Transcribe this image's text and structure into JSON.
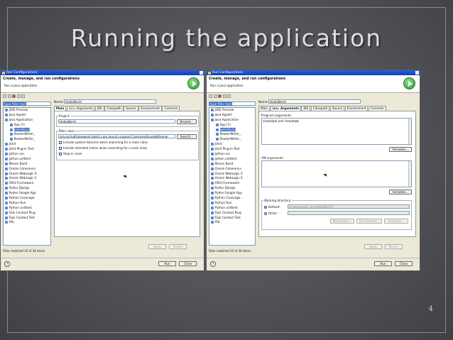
{
  "slide": {
    "title": "Running the application",
    "page_number": "4"
  },
  "dialog": {
    "window_title": "Run Configurations",
    "banner_heading": "Create, manage, and run configurations",
    "banner_sub": "Run a Java application",
    "filter_text": "type filter text",
    "tree_items": [
      {
        "label": "J2EE Preview",
        "level": 0
      },
      {
        "label": "Java Applet",
        "level": 0
      },
      {
        "label": "Java Application",
        "level": 0
      },
      {
        "label": "App (1)",
        "level": 1
      },
      {
        "label": "HelloWorld",
        "level": 1,
        "selected": true
      },
      {
        "label": "ReaderWriter_",
        "level": 1
      },
      {
        "label": "ReaderWriter_",
        "level": 1
      },
      {
        "label": "JUnit",
        "level": 0
      },
      {
        "label": "JUnit Plug-in Test",
        "level": 0
      },
      {
        "label": "Jython run",
        "level": 0
      },
      {
        "label": "Jython unittest",
        "level": 0
      },
      {
        "label": "Maven Build",
        "level": 0
      },
      {
        "label": "Oracle Coherence",
        "level": 0
      },
      {
        "label": "Oracle WebLogic S",
        "level": 0
      },
      {
        "label": "Oracle WebLogic S",
        "level": 0
      },
      {
        "label": "OSGi Framework",
        "level": 0
      },
      {
        "label": "Pydev Django",
        "level": 0
      },
      {
        "label": "Pydev Google App",
        "level": 0
      },
      {
        "label": "Python Coverage",
        "level": 0
      },
      {
        "label": "Python Run",
        "level": 0
      },
      {
        "label": "Python unittest",
        "level": 0
      },
      {
        "label": "Task Context Plug",
        "level": 0
      },
      {
        "label": "Task Context Test",
        "level": 0
      },
      {
        "label": "XSL",
        "level": 0
      }
    ],
    "status": "Filter matched 33 of 34 items",
    "name_label": "Name:",
    "name_value": "HelloWorld",
    "tabs": [
      "Main",
      "(x)= Arguments",
      "JRE",
      "Classpath",
      "Source",
      "Environment",
      "Common"
    ],
    "apply": "Apply",
    "revert": "Revert",
    "run": "Run",
    "close": "Close",
    "help": "?"
  },
  "main_tab": {
    "project_label": "Project:",
    "project_value": "HelloWorld",
    "browse": "Browse...",
    "main_class_label": "Main class:",
    "main_class_value": "org.springframework.batch.core.launch.support.CommandLineJobRunner",
    "search": "Search...",
    "checks": [
      "Include system libraries when searching for a main class",
      "Include inherited mains when searching for a main class",
      "Stop in main"
    ]
  },
  "args_tab": {
    "program_args_label": "Program arguments:",
    "program_args_value": "simpleJob.xml simpleJob",
    "variables": "Variables...",
    "vm_args_label": "VM arguments:",
    "working_dir_label": "Working directory:",
    "default_label": "Default:",
    "default_value": "${workspace_loc:HelloWorld}",
    "other_label": "Other:",
    "workspace": "Workspace...",
    "file_system": "File System...",
    "variables2": "Variables..."
  }
}
